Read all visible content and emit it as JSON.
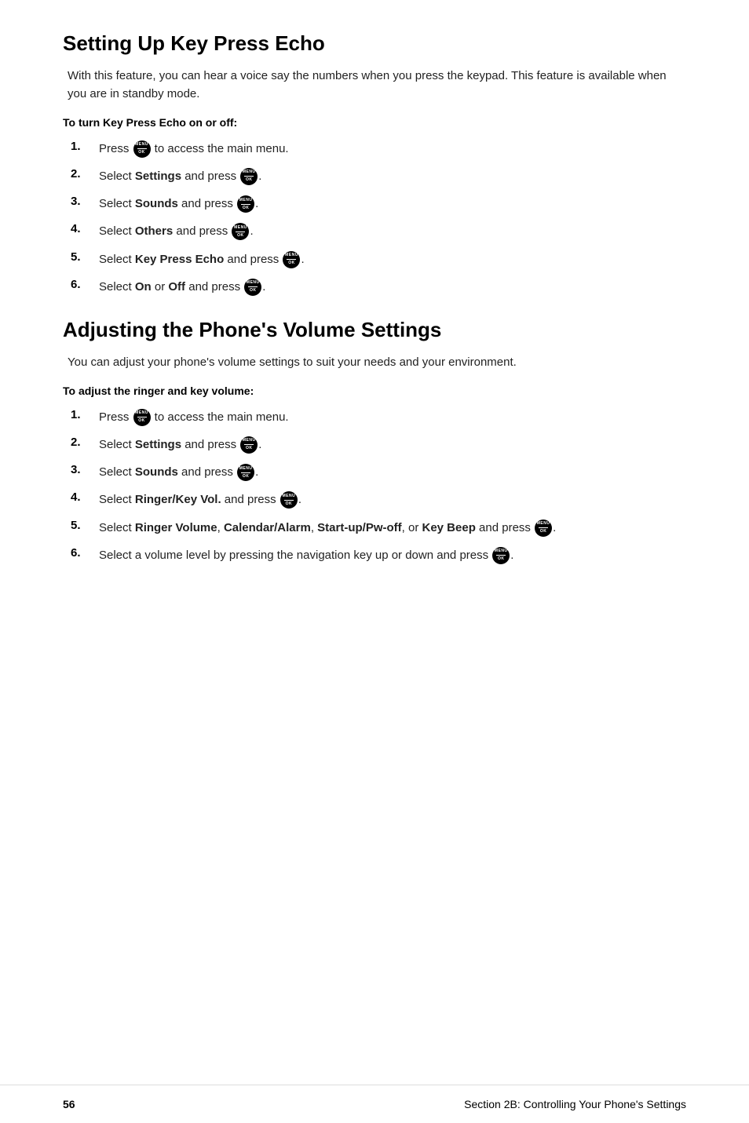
{
  "section1": {
    "title": "Setting Up Key Press Echo",
    "intro": "With this feature, you can hear a voice say the numbers when you press the keypad. This feature is available when you are in standby mode.",
    "sub_heading": "To turn Key Press Echo on or off:",
    "steps": [
      {
        "number": "1.",
        "text_before": "Press ",
        "icon": true,
        "text_after": " to access the main menu."
      },
      {
        "number": "2.",
        "text_before": "Select ",
        "bold": "Settings",
        "text_mid": " and press ",
        "icon": true,
        "text_after": "."
      },
      {
        "number": "3.",
        "text_before": "Select ",
        "bold": "Sounds",
        "text_mid": " and press ",
        "icon": true,
        "text_after": "."
      },
      {
        "number": "4.",
        "text_before": "Select ",
        "bold": "Others",
        "text_mid": " and press ",
        "icon": true,
        "text_after": "."
      },
      {
        "number": "5.",
        "text_before": "Select ",
        "bold": "Key Press Echo",
        "text_mid": " and press ",
        "icon": true,
        "text_after": "."
      },
      {
        "number": "6.",
        "text_before": "Select ",
        "bold_on": "On",
        "text_mid2": " or ",
        "bold_off": "Off",
        "text_mid": " and press ",
        "icon": true,
        "text_after": "."
      }
    ]
  },
  "section2": {
    "title": "Adjusting the Phone's Volume Settings",
    "intro": "You can adjust your phone's volume settings to suit your needs and your environment.",
    "sub_heading": "To adjust the ringer and key volume:",
    "steps": [
      {
        "number": "1.",
        "text_before": "Press ",
        "icon": true,
        "text_after": " to access the main menu."
      },
      {
        "number": "2.",
        "text_before": "Select ",
        "bold": "Settings",
        "text_mid": " and press ",
        "icon": true,
        "text_after": "."
      },
      {
        "number": "3.",
        "text_before": "Select ",
        "bold": "Sounds",
        "text_mid": " and press ",
        "icon": true,
        "text_after": "."
      },
      {
        "number": "4.",
        "text_before": "Select ",
        "bold": "Ringer/Key Vol.",
        "text_mid": " and press ",
        "icon": true,
        "text_after": "."
      },
      {
        "number": "5.",
        "text_before": "Select ",
        "bold_multi": "Ringer Volume",
        "text_mid2": ", ",
        "bold_multi2": "Calendar/Alarm",
        "text_mid3": ", ",
        "bold_multi3": "Start-up/Pw-off",
        "text_mid4": ", or ",
        "bold_multi4": "Key Beep",
        "text_mid": " and press ",
        "icon": true,
        "text_after": "."
      },
      {
        "number": "6.",
        "text_before": "Select a volume level by pressing the navigation key up or down and press ",
        "icon": true,
        "text_after": "."
      }
    ]
  },
  "footer": {
    "page": "56",
    "section": "Section 2B: Controlling Your Phone's Settings"
  }
}
